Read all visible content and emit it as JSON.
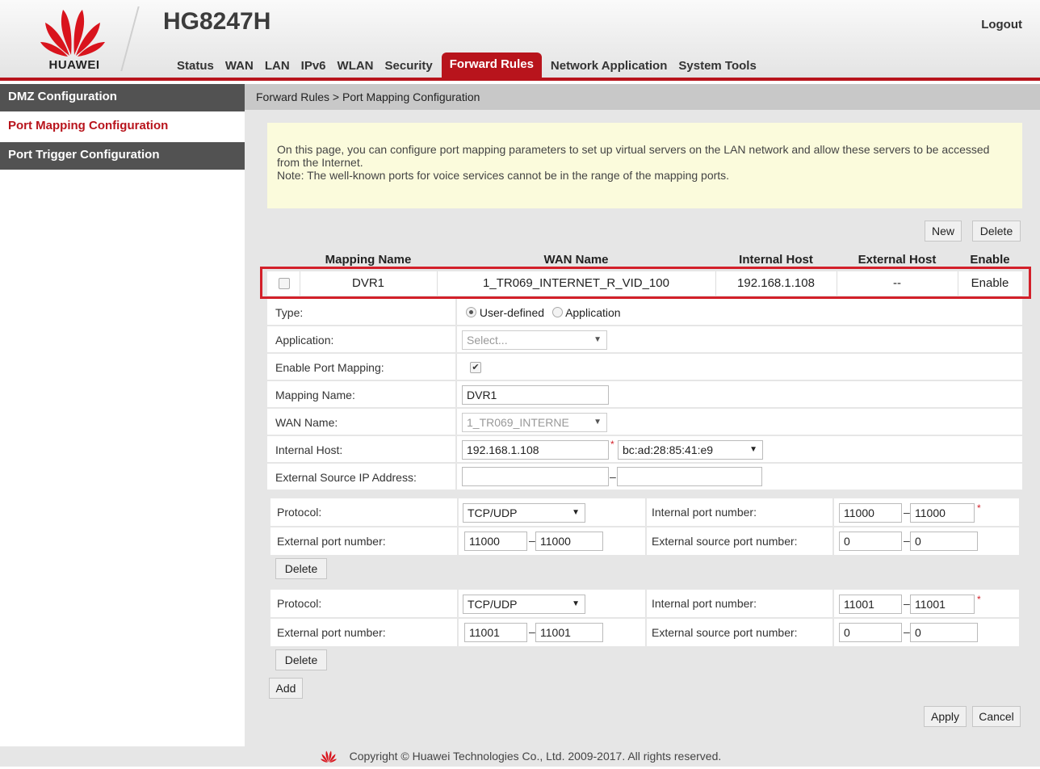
{
  "brand": {
    "name": "HUAWEI",
    "model": "HG8247H",
    "accent": "#b8141c"
  },
  "header": {
    "logout": "Logout"
  },
  "nav": {
    "items": [
      "Status",
      "WAN",
      "LAN",
      "IPv6",
      "WLAN",
      "Security",
      "Forward Rules",
      "Network Application",
      "System Tools"
    ],
    "active": "Forward Rules"
  },
  "sidebar": {
    "items": [
      "DMZ Configuration",
      "Port Mapping Configuration",
      "Port Trigger Configuration"
    ],
    "active": "Port Mapping Configuration"
  },
  "breadcrumb": "Forward Rules > Port Mapping Configuration",
  "notice": {
    "line1": "On this page, you can configure port mapping parameters to set up virtual servers on the LAN network and allow these servers to be accessed from the Internet.",
    "line2": "Note: The well-known ports for voice services cannot be in the range of the mapping ports."
  },
  "buttons": {
    "new": "New",
    "delete": "Delete",
    "apply": "Apply",
    "cancel": "Cancel",
    "add": "Add",
    "row_delete": "Delete"
  },
  "table": {
    "columns": [
      "Mapping Name",
      "WAN Name",
      "Internal Host",
      "External Host",
      "Enable"
    ],
    "rows": [
      {
        "mapping_name": "DVR1",
        "wan_name": "1_TR069_INTERNET_R_VID_100",
        "internal_host": "192.168.1.108",
        "external_host": "--",
        "enable": "Enable",
        "checked": false
      }
    ]
  },
  "form": {
    "type_label": "Type:",
    "type_options": [
      "User-defined",
      "Application"
    ],
    "type_selected": "User-defined",
    "application_label": "Application:",
    "application_value": "Select...",
    "enable_label": "Enable Port Mapping:",
    "enable_checked": true,
    "mapping_name_label": "Mapping Name:",
    "mapping_name_value": "DVR1",
    "wan_name_label": "WAN Name:",
    "wan_name_value": "1_TR069_INTERNE",
    "internal_host_label": "Internal Host:",
    "internal_host_value": "192.168.1.108",
    "internal_host_mac": "bc:ad:28:85:41:e9",
    "ext_src_ip_label": "External Source IP Address:",
    "ext_src_ip_from": "",
    "ext_src_ip_to": ""
  },
  "ports": {
    "labels": {
      "protocol": "Protocol:",
      "internal_port": "Internal port number:",
      "external_port": "External port number:",
      "external_source_port": "External source port number:"
    },
    "entries": [
      {
        "protocol": "TCP/UDP",
        "internal_from": "11000",
        "internal_to": "11000",
        "external_from": "11000",
        "external_to": "11000",
        "ext_src_from": "0",
        "ext_src_to": "0"
      },
      {
        "protocol": "TCP/UDP",
        "internal_from": "11001",
        "internal_to": "11001",
        "external_from": "11001",
        "external_to": "11001",
        "ext_src_from": "0",
        "ext_src_to": "0"
      }
    ]
  },
  "footer": {
    "copyright": "Copyright © Huawei Technologies Co., Ltd. 2009-2017. All rights reserved."
  }
}
